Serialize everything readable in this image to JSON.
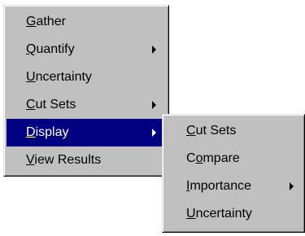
{
  "main_menu": {
    "items": [
      {
        "pre": "",
        "key": "G",
        "post": "ather",
        "submenu": false
      },
      {
        "pre": "",
        "key": "Q",
        "post": "uantify",
        "submenu": true
      },
      {
        "pre": "",
        "key": "U",
        "post": "ncertainty",
        "submenu": false
      },
      {
        "pre": "",
        "key": "C",
        "post": "ut Sets",
        "submenu": true
      },
      {
        "pre": "",
        "key": "D",
        "post": "isplay",
        "submenu": true,
        "highlighted": true
      },
      {
        "pre": "",
        "key": "V",
        "post": "iew Results",
        "submenu": false
      }
    ]
  },
  "display_submenu": {
    "items": [
      {
        "pre": "",
        "key": "C",
        "post": "ut Sets",
        "submenu": false
      },
      {
        "pre": "C",
        "key": "o",
        "post": "mpare",
        "submenu": false
      },
      {
        "pre": "",
        "key": "I",
        "post": "mportance",
        "submenu": true
      },
      {
        "pre": "",
        "key": "U",
        "post": "ncertainty",
        "submenu": false
      }
    ]
  },
  "colors": {
    "menu_bg": "#c0c0c0",
    "highlight_bg": "#000080",
    "highlight_text": "#ffffff"
  }
}
